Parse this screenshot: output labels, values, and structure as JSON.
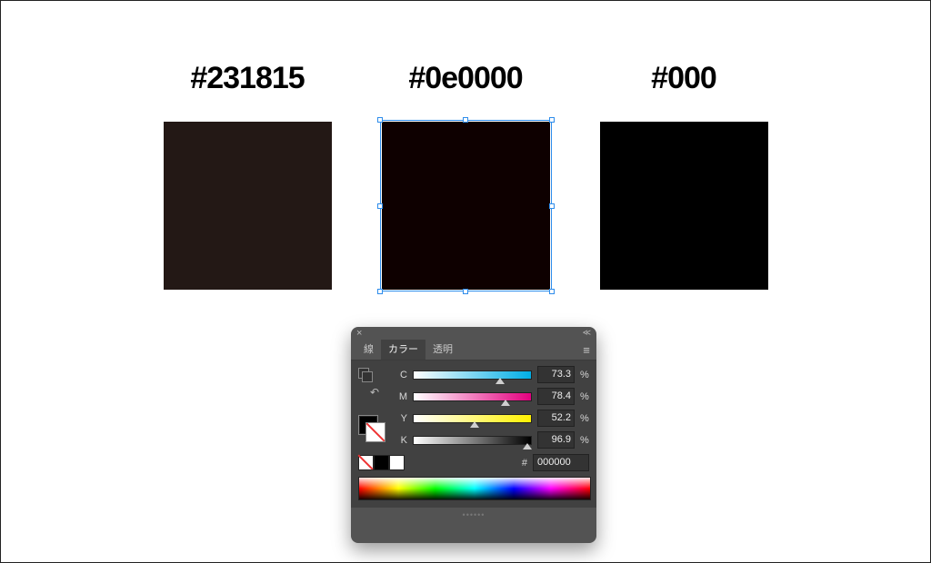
{
  "swatches": [
    {
      "label": "#231815",
      "color": "#231815",
      "selected": false
    },
    {
      "label": "#0e0000",
      "color": "#0e0000",
      "selected": true
    },
    {
      "label": "#000",
      "color": "#000000",
      "selected": false
    }
  ],
  "panel": {
    "tabs": {
      "stroke": "線",
      "color": "カラー",
      "transparency": "透明"
    },
    "activeTab": "color",
    "channels": [
      {
        "label": "C",
        "value": "73.3",
        "trackClass": "track-c"
      },
      {
        "label": "M",
        "value": "78.4",
        "trackClass": "track-m"
      },
      {
        "label": "Y",
        "value": "52.2",
        "trackClass": "track-y"
      },
      {
        "label": "K",
        "value": "96.9",
        "trackClass": "track-k"
      }
    ],
    "hexHash": "#",
    "hexValue": "000000",
    "percent": "%"
  }
}
